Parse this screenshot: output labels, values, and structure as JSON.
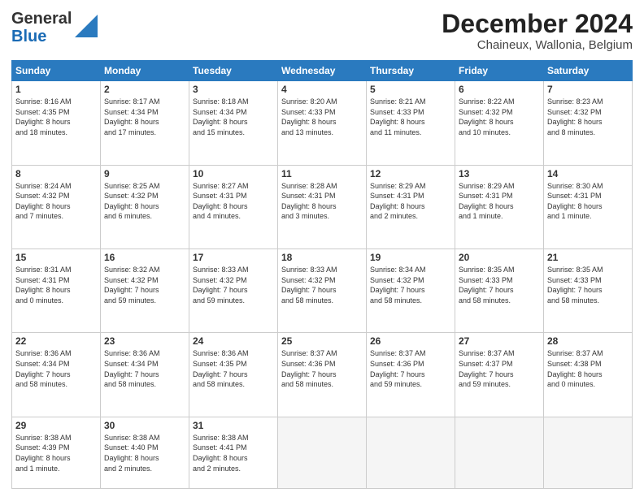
{
  "header": {
    "logo_general": "General",
    "logo_blue": "Blue",
    "month_title": "December 2024",
    "subtitle": "Chaineux, Wallonia, Belgium"
  },
  "days_of_week": [
    "Sunday",
    "Monday",
    "Tuesday",
    "Wednesday",
    "Thursday",
    "Friday",
    "Saturday"
  ],
  "weeks": [
    [
      {
        "day": "1",
        "info": "Sunrise: 8:16 AM\nSunset: 4:35 PM\nDaylight: 8 hours\nand 18 minutes."
      },
      {
        "day": "2",
        "info": "Sunrise: 8:17 AM\nSunset: 4:34 PM\nDaylight: 8 hours\nand 17 minutes."
      },
      {
        "day": "3",
        "info": "Sunrise: 8:18 AM\nSunset: 4:34 PM\nDaylight: 8 hours\nand 15 minutes."
      },
      {
        "day": "4",
        "info": "Sunrise: 8:20 AM\nSunset: 4:33 PM\nDaylight: 8 hours\nand 13 minutes."
      },
      {
        "day": "5",
        "info": "Sunrise: 8:21 AM\nSunset: 4:33 PM\nDaylight: 8 hours\nand 11 minutes."
      },
      {
        "day": "6",
        "info": "Sunrise: 8:22 AM\nSunset: 4:32 PM\nDaylight: 8 hours\nand 10 minutes."
      },
      {
        "day": "7",
        "info": "Sunrise: 8:23 AM\nSunset: 4:32 PM\nDaylight: 8 hours\nand 8 minutes."
      }
    ],
    [
      {
        "day": "8",
        "info": "Sunrise: 8:24 AM\nSunset: 4:32 PM\nDaylight: 8 hours\nand 7 minutes."
      },
      {
        "day": "9",
        "info": "Sunrise: 8:25 AM\nSunset: 4:32 PM\nDaylight: 8 hours\nand 6 minutes."
      },
      {
        "day": "10",
        "info": "Sunrise: 8:27 AM\nSunset: 4:31 PM\nDaylight: 8 hours\nand 4 minutes."
      },
      {
        "day": "11",
        "info": "Sunrise: 8:28 AM\nSunset: 4:31 PM\nDaylight: 8 hours\nand 3 minutes."
      },
      {
        "day": "12",
        "info": "Sunrise: 8:29 AM\nSunset: 4:31 PM\nDaylight: 8 hours\nand 2 minutes."
      },
      {
        "day": "13",
        "info": "Sunrise: 8:29 AM\nSunset: 4:31 PM\nDaylight: 8 hours\nand 1 minute."
      },
      {
        "day": "14",
        "info": "Sunrise: 8:30 AM\nSunset: 4:31 PM\nDaylight: 8 hours\nand 1 minute."
      }
    ],
    [
      {
        "day": "15",
        "info": "Sunrise: 8:31 AM\nSunset: 4:31 PM\nDaylight: 8 hours\nand 0 minutes."
      },
      {
        "day": "16",
        "info": "Sunrise: 8:32 AM\nSunset: 4:32 PM\nDaylight: 7 hours\nand 59 minutes."
      },
      {
        "day": "17",
        "info": "Sunrise: 8:33 AM\nSunset: 4:32 PM\nDaylight: 7 hours\nand 59 minutes."
      },
      {
        "day": "18",
        "info": "Sunrise: 8:33 AM\nSunset: 4:32 PM\nDaylight: 7 hours\nand 58 minutes."
      },
      {
        "day": "19",
        "info": "Sunrise: 8:34 AM\nSunset: 4:32 PM\nDaylight: 7 hours\nand 58 minutes."
      },
      {
        "day": "20",
        "info": "Sunrise: 8:35 AM\nSunset: 4:33 PM\nDaylight: 7 hours\nand 58 minutes."
      },
      {
        "day": "21",
        "info": "Sunrise: 8:35 AM\nSunset: 4:33 PM\nDaylight: 7 hours\nand 58 minutes."
      }
    ],
    [
      {
        "day": "22",
        "info": "Sunrise: 8:36 AM\nSunset: 4:34 PM\nDaylight: 7 hours\nand 58 minutes."
      },
      {
        "day": "23",
        "info": "Sunrise: 8:36 AM\nSunset: 4:34 PM\nDaylight: 7 hours\nand 58 minutes."
      },
      {
        "day": "24",
        "info": "Sunrise: 8:36 AM\nSunset: 4:35 PM\nDaylight: 7 hours\nand 58 minutes."
      },
      {
        "day": "25",
        "info": "Sunrise: 8:37 AM\nSunset: 4:36 PM\nDaylight: 7 hours\nand 58 minutes."
      },
      {
        "day": "26",
        "info": "Sunrise: 8:37 AM\nSunset: 4:36 PM\nDaylight: 7 hours\nand 59 minutes."
      },
      {
        "day": "27",
        "info": "Sunrise: 8:37 AM\nSunset: 4:37 PM\nDaylight: 7 hours\nand 59 minutes."
      },
      {
        "day": "28",
        "info": "Sunrise: 8:37 AM\nSunset: 4:38 PM\nDaylight: 8 hours\nand 0 minutes."
      }
    ],
    [
      {
        "day": "29",
        "info": "Sunrise: 8:38 AM\nSunset: 4:39 PM\nDaylight: 8 hours\nand 1 minute."
      },
      {
        "day": "30",
        "info": "Sunrise: 8:38 AM\nSunset: 4:40 PM\nDaylight: 8 hours\nand 2 minutes."
      },
      {
        "day": "31",
        "info": "Sunrise: 8:38 AM\nSunset: 4:41 PM\nDaylight: 8 hours\nand 2 minutes."
      },
      null,
      null,
      null,
      null
    ]
  ]
}
